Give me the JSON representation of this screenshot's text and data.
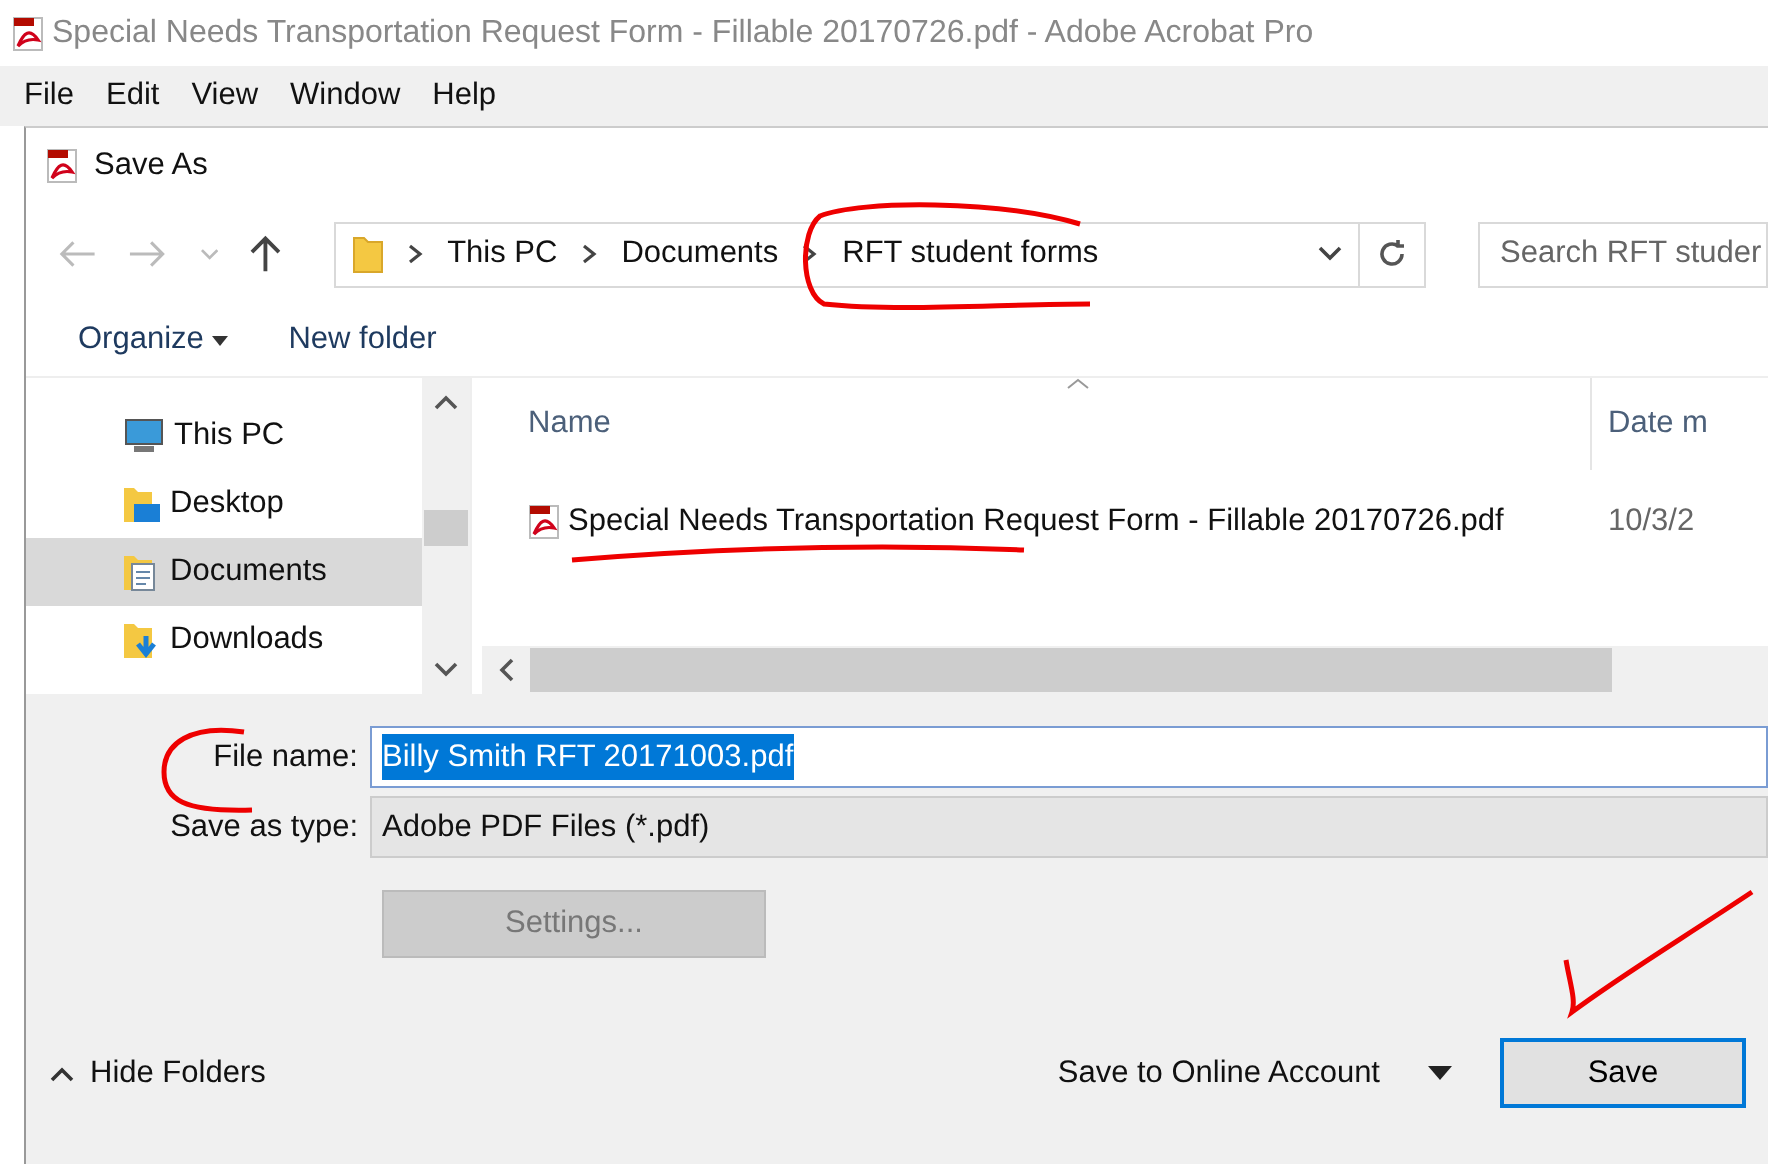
{
  "app_title": "Special Needs Transportation Request Form - Fillable 20170726.pdf - Adobe Acrobat Pro",
  "menu": [
    "File",
    "Edit",
    "View",
    "Window",
    "Help"
  ],
  "dialog": {
    "title": "Save As",
    "breadcrumb": [
      "This PC",
      "Documents",
      "RFT student forms"
    ],
    "search": {
      "placeholder": "Search RFT studer"
    },
    "toolbar": [
      {
        "label": "Organize",
        "kind": "menu"
      },
      {
        "label": "New folder",
        "kind": "plain"
      }
    ],
    "nav_items": [
      {
        "label": "This PC",
        "kind": "pc",
        "selected": false
      },
      {
        "label": "Desktop",
        "kind": "desktop",
        "selected": false
      },
      {
        "label": "Documents",
        "kind": "documents",
        "selected": true
      },
      {
        "label": "Downloads",
        "kind": "downloads",
        "selected": false
      }
    ],
    "columns": [
      "Name",
      "Date m"
    ],
    "files": [
      {
        "name": "Special Needs Transportation Request Form - Fillable 20170726.pdf",
        "date": "10/3/2"
      }
    ],
    "file_name": {
      "label": "File name:",
      "value": "Billy Smith RFT 20171003.pdf",
      "text_selected": true
    },
    "save_type": {
      "label": "Save as type:",
      "value": "Adobe PDF Files (*.pdf)"
    },
    "settings_button": {
      "label": "Settings...",
      "disabled": true
    },
    "hide_folders": "Hide Folders",
    "online_account": "Save to Online Account",
    "save_button": "Save"
  }
}
